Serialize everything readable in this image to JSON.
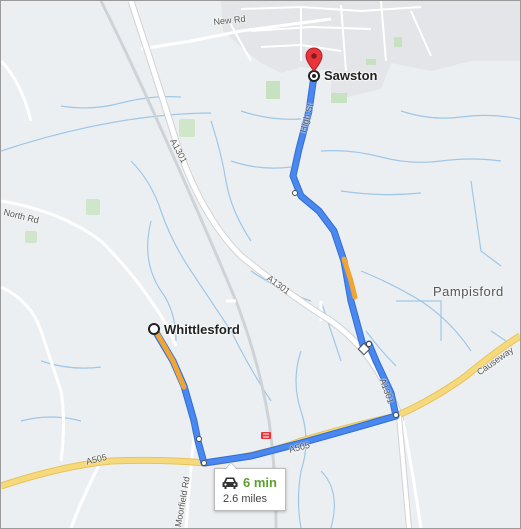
{
  "map": {
    "places": {
      "origin": "Whittlesford",
      "destination": "Sawston",
      "town": "Pampisford"
    },
    "roads": {
      "new_rd": "New Rd",
      "north_rd": "North Rd",
      "a1301_upper": "A1301",
      "a1301_lower": "A1301",
      "a1301_east": "A1301",
      "high_st": "High St",
      "a505_west": "A505",
      "a505_center": "A505",
      "moorfield_rd": "Moorfield Rd",
      "causeway": "Causeway"
    },
    "route": {
      "mode_icon": "car-icon",
      "duration": "6 min",
      "distance": "2.6 miles"
    },
    "colors": {
      "route": "#4a88f0",
      "route_outline": "#2f6fd6",
      "traffic_slow": "#f0a535",
      "destination_pin": "#e8343a",
      "major_road": "#f5d97c",
      "water": "#9ec7e8"
    }
  }
}
